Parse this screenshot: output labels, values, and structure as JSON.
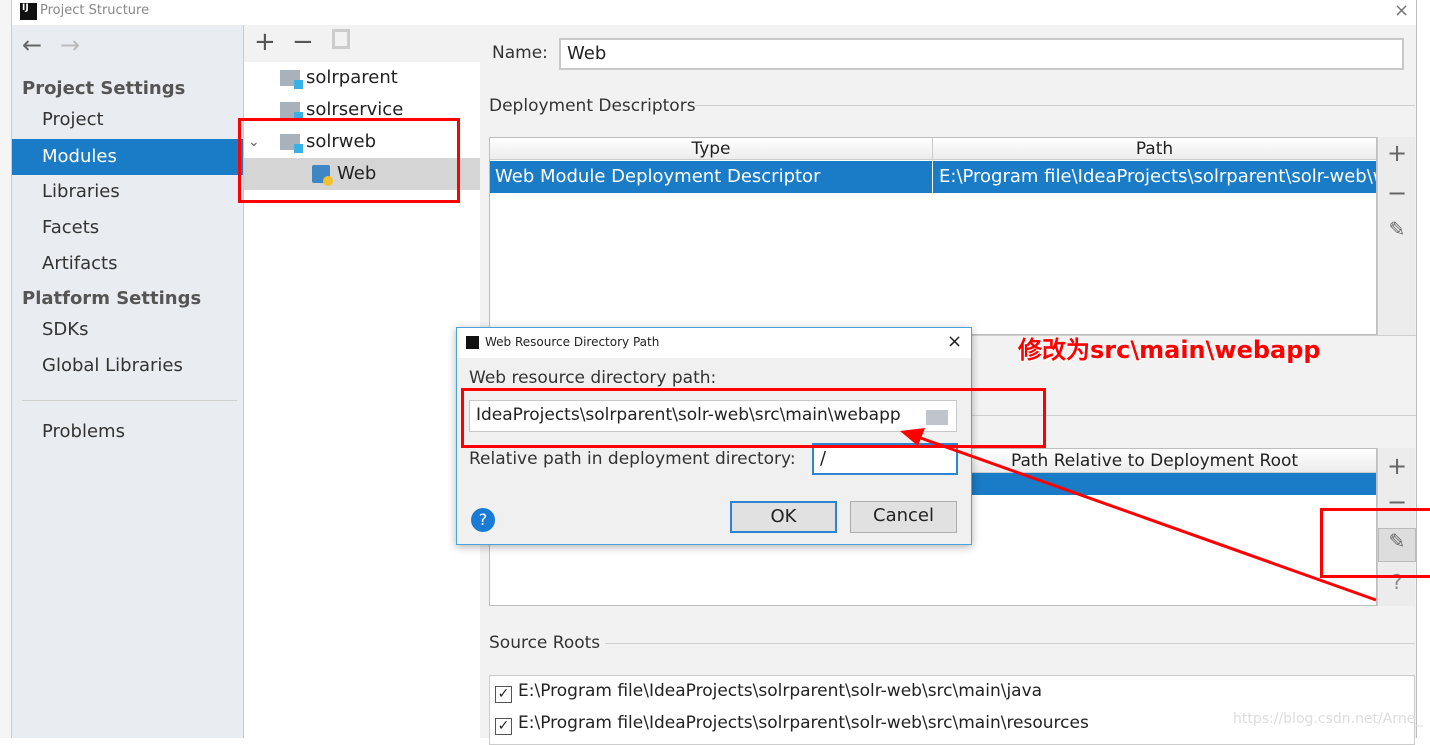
{
  "window": {
    "title": "Project Structure",
    "logo": "IJ"
  },
  "sidebar": {
    "back_icon": "arrow-left",
    "forward_icon": "arrow-right",
    "project_settings": "Project Settings",
    "items": [
      {
        "label": "Project"
      },
      {
        "label": "Modules"
      },
      {
        "label": "Libraries"
      },
      {
        "label": "Facets"
      },
      {
        "label": "Artifacts"
      }
    ],
    "platform_settings": "Platform Settings",
    "platform_items": [
      {
        "label": "SDKs"
      },
      {
        "label": "Global Libraries"
      }
    ],
    "problems": "Problems",
    "selected": "Modules"
  },
  "tree": {
    "toolbar": [
      "plus-icon",
      "minus-icon",
      "copy-icon"
    ],
    "nodes": [
      {
        "label": "solrparent"
      },
      {
        "label": "solrservice"
      },
      {
        "label": "solrweb"
      },
      {
        "label": "Web"
      }
    ],
    "selected": "Web"
  },
  "detail": {
    "name_label": "Name:",
    "name_value": "Web",
    "deployment_descriptors": "Deployment Descriptors",
    "dd_columns": [
      "Type",
      "Path"
    ],
    "dd_rows": [
      {
        "type": "Web Module Deployment Descriptor",
        "path": "E:\\Program file\\IdeaProjects\\solrparent\\solr-web\\w"
      }
    ],
    "web_roots_column": "Path Relative to Deployment Root",
    "source_roots": "Source Roots",
    "source_root_items": [
      {
        "path": "E:\\Program file\\IdeaProjects\\solrparent\\solr-web\\src\\main\\java",
        "checked": true
      },
      {
        "path": "E:\\Program file\\IdeaProjects\\solrparent\\solr-web\\src\\main\\resources",
        "checked": true
      }
    ]
  },
  "dialog": {
    "title": "Web Resource Directory Path",
    "path_label": "Web resource directory path:",
    "path_value": "IdeaProjects\\solrparent\\solr-web\\src\\main\\webapp",
    "relative_label": "Relative path in deployment directory:",
    "relative_value": "/",
    "ok": "OK",
    "cancel": "Cancel",
    "help": "?"
  },
  "annotation": {
    "text": "修改为src\\main\\webapp",
    "color": "#ff0000"
  },
  "watermark": "https://blog.csdn.net/Arne_",
  "colors": {
    "selection": "#1a7bc6",
    "annotation": "#ff0000"
  }
}
